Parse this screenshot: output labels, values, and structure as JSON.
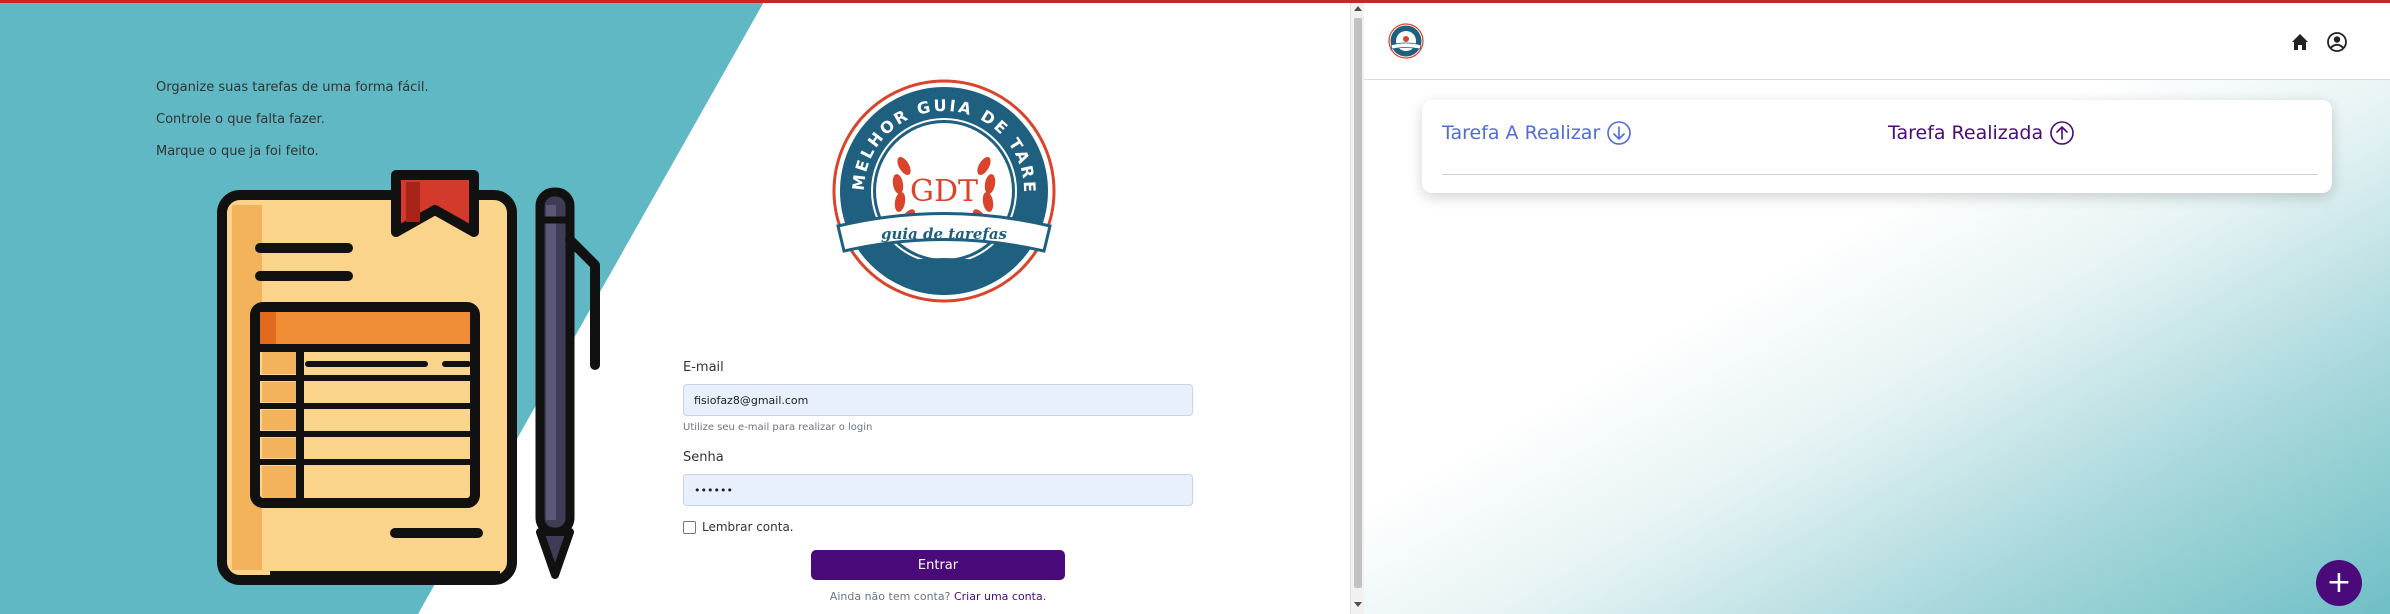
{
  "login": {
    "taglines": [
      "Organize suas tarefas de uma forma fácil.",
      "Controle o que falta fazer.",
      "Marque o que ja foi feito."
    ],
    "logo": {
      "ring_text": "MELHOR GUIA DE TAREFA ON-LINE",
      "monogram": "GDT",
      "banner": "guia de tarefas"
    },
    "email_label": "E-mail",
    "email_value": "fisiofaz8@gmail.com",
    "email_hint": "Utilize seu e-mail para realizar o login",
    "password_label": "Senha",
    "password_value": "••••••",
    "remember_label": "Lembrar conta.",
    "submit_label": "Entrar",
    "signup_prompt": "Ainda não tem conta?",
    "signup_link": "Criar uma conta."
  },
  "app": {
    "tabs": [
      {
        "label": "Tarefa A Realizar",
        "icon": "arrow-down-circle-icon"
      },
      {
        "label": "Tarefa Realizada",
        "icon": "arrow-up-circle-icon"
      }
    ],
    "nav_icons": [
      "home-icon",
      "user-circle-icon"
    ],
    "fab_label": "+"
  },
  "colors": {
    "teal": "#5fb8c3",
    "purple": "#4a0a7a",
    "blue_link": "#4f6bd8",
    "logo_blue": "#1f5f7f",
    "logo_red": "#d9442a"
  }
}
